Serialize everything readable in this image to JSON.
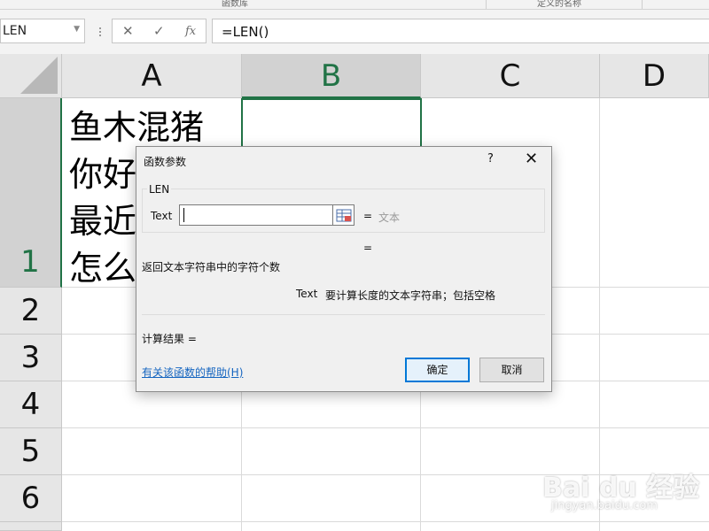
{
  "ribbon": {
    "groups": [
      "函数库",
      "定义的名称"
    ]
  },
  "formula_bar": {
    "name_box": "LEN",
    "cancel_glyph": "✕",
    "enter_glyph": "✓",
    "insert_function_glyph": "fx",
    "formula": "=LEN()"
  },
  "sheet": {
    "columns": [
      "A",
      "B",
      "C",
      "D"
    ],
    "selected_column": "B",
    "rows": [
      "1",
      "2",
      "3",
      "4",
      "5",
      "6"
    ],
    "selected_row": "1",
    "cell_a1": "鱼木混猪\n你好\n最近\n怎么",
    "colors": {
      "accent": "#217346",
      "header_bg": "#e6e6e6",
      "grid": "#dadada"
    }
  },
  "dialog": {
    "title": "函数参数",
    "help_glyph": "?",
    "close_glyph": "✕",
    "function_name": "LEN",
    "arg_name": "Text",
    "arg_value": "",
    "eq": "=",
    "arg_result_hint": "文本",
    "function_description": "返回文本字符串中的字符个数",
    "arg_desc_name": "Text",
    "arg_desc_text": "要计算长度的文本字符串；包括空格",
    "result_label": "计算结果 =",
    "help_link": "有关该函数的帮助(H)",
    "ok_label": "确定",
    "cancel_label": "取消",
    "colors": {
      "link": "#1565c0",
      "ok_border": "#0078d7"
    }
  },
  "watermark": {
    "text": "Bai du 经验",
    "url": "jingyan.baidu.com"
  }
}
